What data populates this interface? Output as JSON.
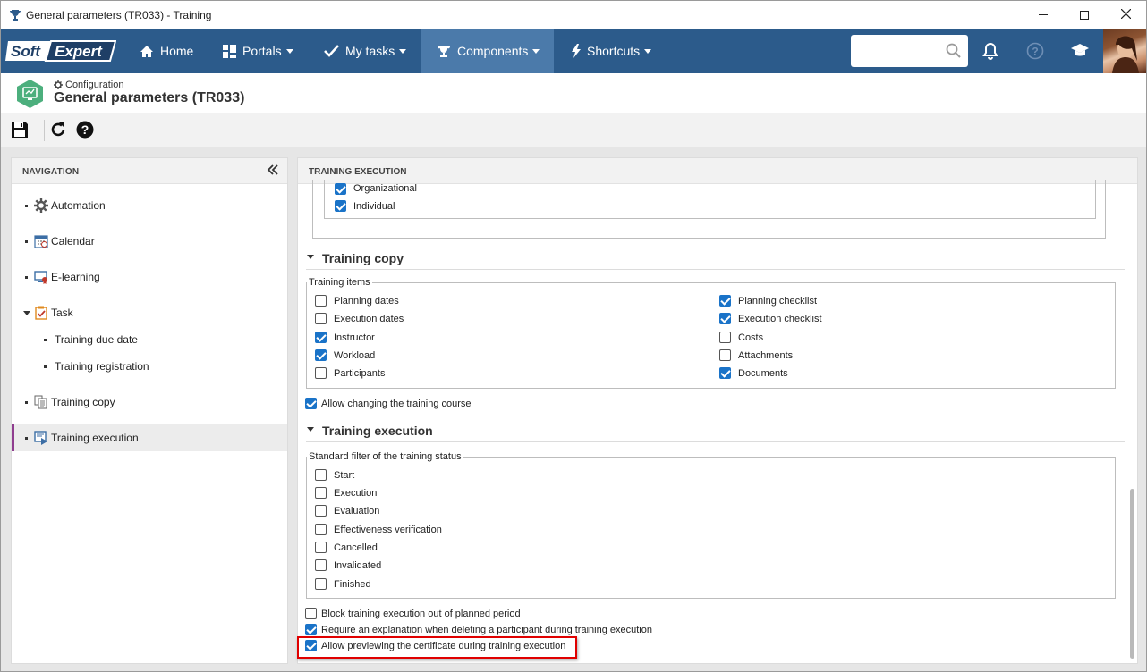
{
  "window": {
    "title": "General parameters (TR033) - Training",
    "icon": "trophy-icon",
    "controls": [
      "minimize-icon",
      "maximize-icon",
      "close-icon"
    ]
  },
  "topnav": {
    "logo_left": "Soft",
    "logo_right": "Expert",
    "items": [
      {
        "label": "Home",
        "icon": "home-icon"
      },
      {
        "label": "Portals",
        "icon": "portals-icon"
      },
      {
        "label": "My tasks",
        "icon": "check-icon"
      },
      {
        "label": "Components",
        "icon": "trophy-icon"
      },
      {
        "label": "Shortcuts",
        "icon": "bolt-icon"
      }
    ],
    "search_placeholder": "",
    "right_icons": [
      "bell-icon",
      "help-circle-icon",
      "graduation-cap-icon",
      "avatar"
    ],
    "colors": {
      "bar": "#2c5b8b",
      "active": "#4b7aaa"
    }
  },
  "header": {
    "breadcrumb": "Configuration",
    "title": "General parameters (TR033)"
  },
  "toolbar": {
    "buttons": [
      "save-icon",
      "refresh-icon",
      "help-icon"
    ]
  },
  "navigation": {
    "heading": "NAVIGATION",
    "items": [
      {
        "label": "Automation",
        "icon": "gear-icon",
        "level": 0
      },
      {
        "label": "Calendar",
        "icon": "calendar-icon",
        "level": 0
      },
      {
        "label": "E-learning",
        "icon": "elearning-icon",
        "level": 0
      },
      {
        "label": "Task",
        "icon": "clipboard-icon",
        "level": 0,
        "expanded": true
      },
      {
        "label": "Training due date",
        "level": 1
      },
      {
        "label": "Training registration",
        "level": 1
      },
      {
        "label": "Training copy",
        "icon": "copy-icon",
        "level": 0
      },
      {
        "label": "Training execution",
        "icon": "execution-icon",
        "level": 0,
        "selected": true
      }
    ]
  },
  "content": {
    "heading": "TRAINING EXECUTION",
    "top_partial": [
      {
        "label": "Organizational",
        "checked": true
      },
      {
        "label": "Individual",
        "checked": true
      }
    ],
    "training_copy": {
      "title": "Training copy",
      "fieldset_legend": "Training items",
      "left": [
        {
          "label": "Planning dates",
          "checked": false
        },
        {
          "label": "Execution dates",
          "checked": false
        },
        {
          "label": "Instructor",
          "checked": true
        },
        {
          "label": "Workload",
          "checked": true
        },
        {
          "label": "Participants",
          "checked": false
        }
      ],
      "right": [
        {
          "label": "Planning checklist",
          "checked": true
        },
        {
          "label": "Execution checklist",
          "checked": true
        },
        {
          "label": "Costs",
          "checked": false
        },
        {
          "label": "Attachments",
          "checked": false
        },
        {
          "label": "Documents",
          "checked": true
        }
      ],
      "allow_change": {
        "label": "Allow changing the training course",
        "checked": true
      }
    },
    "training_execution": {
      "title": "Training execution",
      "fieldset_legend": "Standard filter of the training status",
      "statuses": [
        {
          "label": "Start",
          "checked": false
        },
        {
          "label": "Execution",
          "checked": false
        },
        {
          "label": "Evaluation",
          "checked": false
        },
        {
          "label": "Effectiveness verification",
          "checked": false
        },
        {
          "label": "Cancelled",
          "checked": false
        },
        {
          "label": "Invalidated",
          "checked": false
        },
        {
          "label": "Finished",
          "checked": false
        }
      ],
      "options": [
        {
          "label": "Block training execution out of planned period",
          "checked": false
        },
        {
          "label": "Require an explanation when deleting a participant during training execution",
          "checked": true
        },
        {
          "label": "Allow previewing the certificate during training execution",
          "checked": true
        }
      ]
    },
    "highlight_color": "#e00000"
  }
}
